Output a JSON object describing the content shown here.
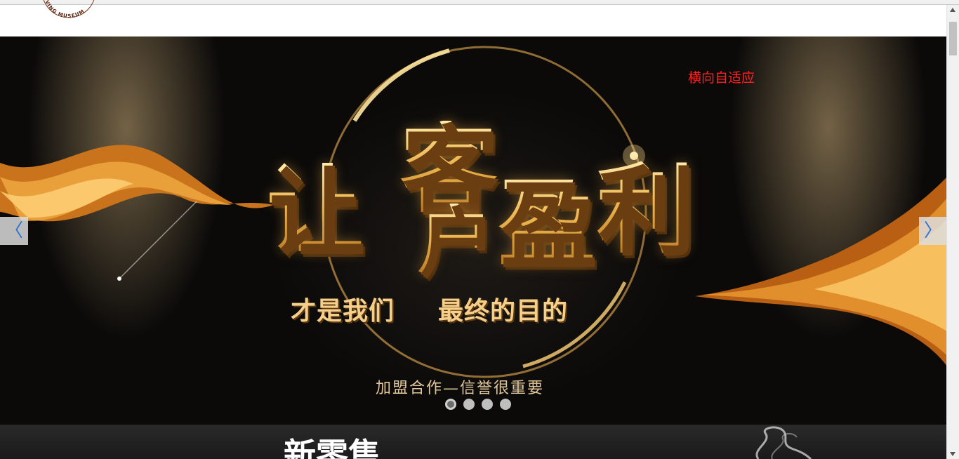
{
  "header": {
    "logo_text": "LIVING MUSEUM"
  },
  "banner": {
    "adaptive_note": "横向自适应",
    "slogan_chars": [
      "让",
      "客",
      "户",
      "盈",
      "利"
    ],
    "sub_left": "才是我们",
    "sub_right": "最终的目的",
    "tagline": "加盟合作—信誉很重要",
    "prev_symbol": "〈",
    "next_symbol": "〉",
    "dots": [
      {
        "active": true
      },
      {
        "active": false
      },
      {
        "active": false
      },
      {
        "active": false
      }
    ]
  },
  "section2": {
    "title": "新零售"
  },
  "colors": {
    "note_red": "#ff2020",
    "arrow_blue": "#2a6fd6",
    "gold": "#e8b85a"
  }
}
